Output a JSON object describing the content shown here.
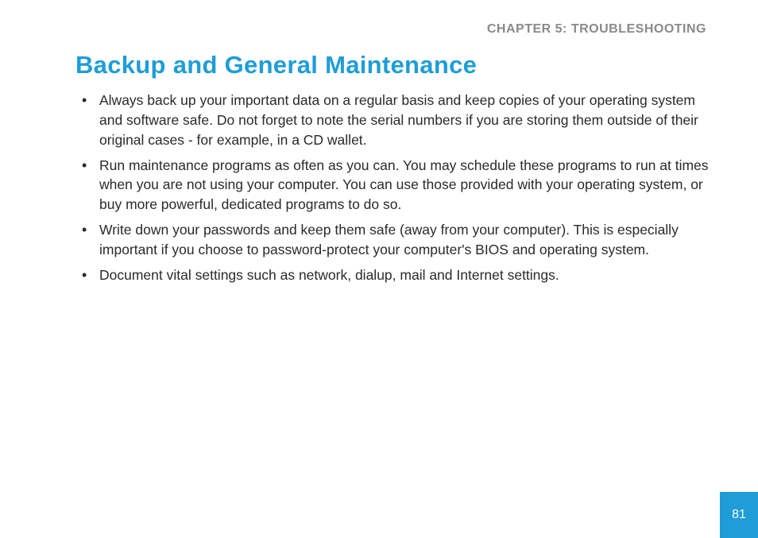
{
  "chapter_label": "CHAPTER 5: TROUBLESHOOTING",
  "heading": "Backup and General Maintenance",
  "bullets": [
    "Always back up your important data on a regular basis and keep copies of your operating system and software safe. Do not forget to note the serial numbers if you are storing them outside of their original cases - for example, in a CD wallet.",
    "Run maintenance programs as often as you can. You may schedule these programs to run at times when you are not using your computer. You can use those provided with your operating system, or buy more powerful, dedicated programs to do so.",
    "Write down your passwords and keep them safe (away from your computer). This is especially important if you choose to password-protect your computer's BIOS and operating system.",
    "Document vital settings such as network, dialup, mail and Internet settings."
  ],
  "page_number": "81",
  "colors": {
    "accent": "#1e9dd8",
    "header_gray": "#8a8a8a",
    "body_text": "#2a2a2a"
  }
}
